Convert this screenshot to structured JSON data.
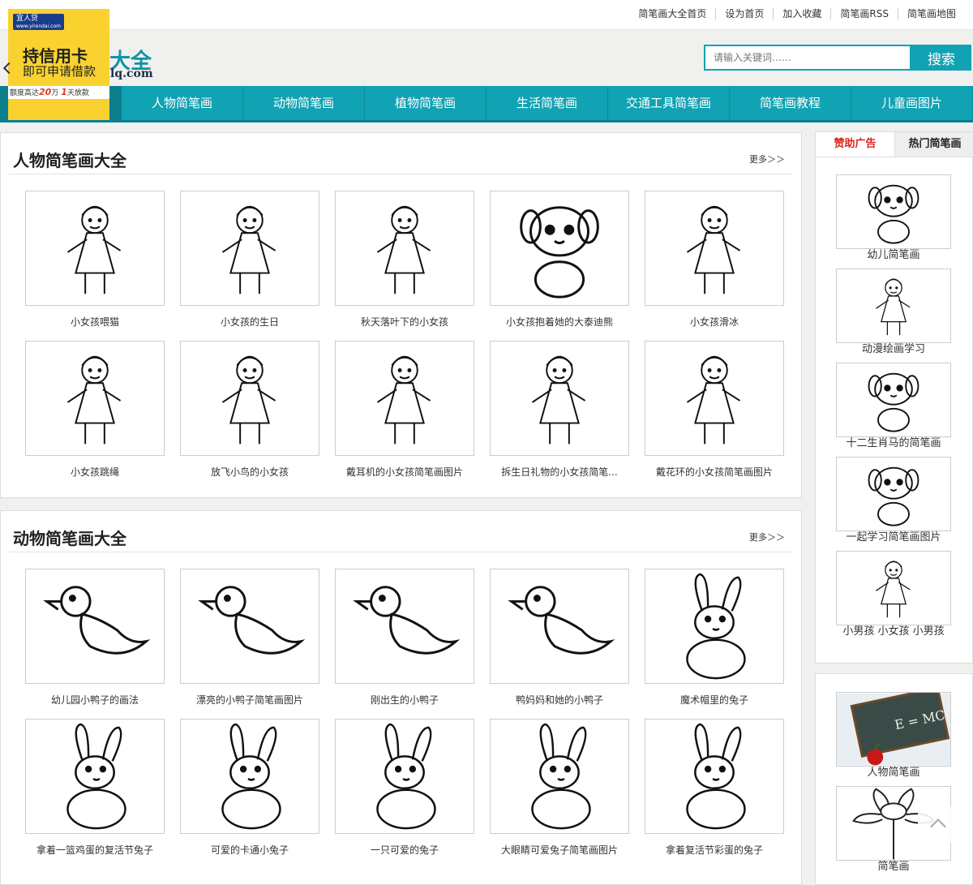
{
  "toplinks": [
    "简笔画大全首页",
    "设为首页",
    "加入收藏",
    "简笔画RSS",
    "简笔画地图"
  ],
  "logo": {
    "text": "大全",
    "sub": "lq.com"
  },
  "ad": {
    "brand": "宜人贷",
    "brand_url": "www.yirendai.com",
    "title": "持信用卡",
    "subtitle": "即可申请借款",
    "bottom_pre": "额度高达",
    "amount": "20",
    "amount_unit": "万",
    "days": "1",
    "days_unit": "天放款"
  },
  "search": {
    "placeholder": "请输入关键词……",
    "button": "搜索"
  },
  "nav": [
    "人物简笔画",
    "动物简笔画",
    "植物简笔画",
    "生活简笔画",
    "交通工具简笔画",
    "简笔画教程",
    "儿童画图片"
  ],
  "sections": [
    {
      "title": "人物简笔画大全",
      "more": "更多＞＞",
      "items": [
        "小女孩喂猫",
        "小女孩的生日",
        "秋天落叶下的小女孩",
        "小女孩抱着她的大泰迪熊",
        "小女孩滑冰",
        "小女孩跳绳",
        "放飞小鸟的小女孩",
        "戴耳机的小女孩简笔画图片",
        "拆生日礼物的小女孩简笔...",
        "戴花环的小女孩简笔画图片"
      ]
    },
    {
      "title": "动物简笔画大全",
      "more": "更多＞＞",
      "items": [
        "幼儿园小鸭子的画法",
        "漂亮的小鸭子简笔画图片",
        "刚出生的小鸭子",
        "鸭妈妈和她的小鸭子",
        "魔术帽里的兔子",
        "拿着一篮鸡蛋的复活节兔子",
        "可爱的卡通小兔子",
        "一只可爱的兔子",
        "大眼睛可爱兔子简笔画图片",
        "拿着复活节彩蛋的兔子"
      ]
    }
  ],
  "sidebar": {
    "tabs": [
      "赞助广告",
      "热门简笔画"
    ],
    "items": [
      "幼儿简笔画",
      "动漫绘画学习",
      "十二生肖马的简笔画",
      "一起学习简笔画图片",
      "小男孩 小女孩 小男孩"
    ]
  },
  "sidebar2": {
    "items": [
      "人物简笔画",
      "简笔画"
    ],
    "chalkboard": "E = MC²"
  }
}
